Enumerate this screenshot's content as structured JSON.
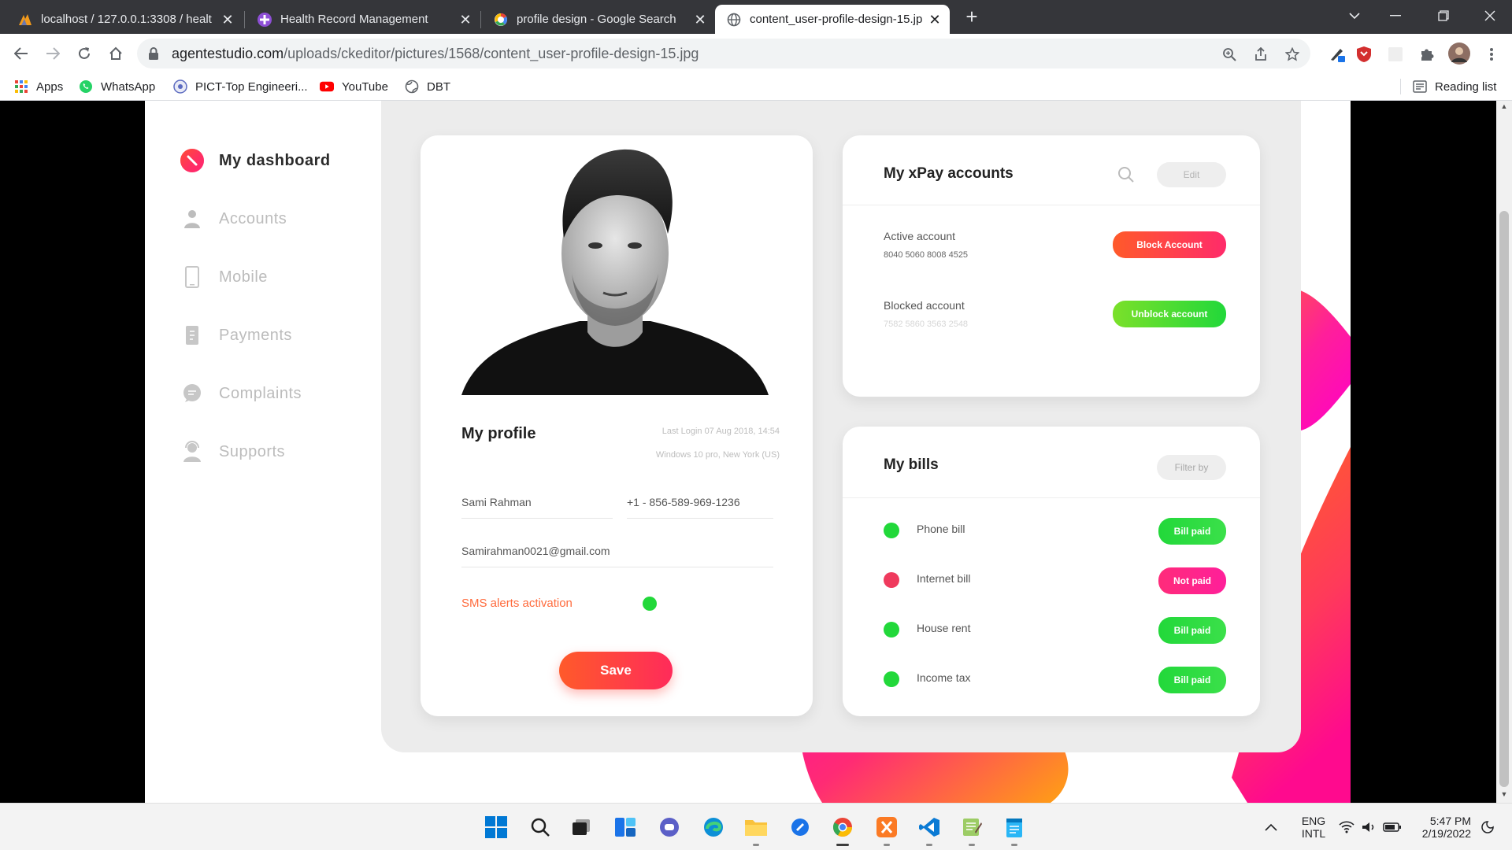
{
  "browser": {
    "tabs": [
      {
        "title": "localhost / 127.0.0.1:3308 / healt",
        "icon": "phpmyadmin-icon",
        "active": false
      },
      {
        "title": "Health Record Management",
        "icon": "plus-icon",
        "active": false
      },
      {
        "title": "profile design - Google Search",
        "icon": "google-icon",
        "active": false
      },
      {
        "title": "content_user-profile-design-15.jp",
        "icon": "globe-icon",
        "active": true
      }
    ],
    "close_glyph": "✕",
    "new_tab_glyph": "+",
    "url_host": "agentestudio.com",
    "url_path": "/uploads/ckeditor/pictures/1568/content_user-profile-design-15.jpg"
  },
  "bookmarks": [
    {
      "label": "Apps",
      "icon": "apps-grid-icon"
    },
    {
      "label": "WhatsApp",
      "icon": "whatsapp-icon"
    },
    {
      "label": "PICT-Top Engineeri...",
      "icon": "pict-logo-icon"
    },
    {
      "label": "YouTube",
      "icon": "youtube-icon"
    },
    {
      "label": "DBT",
      "icon": "globe-icon"
    }
  ],
  "reading_list": "Reading list",
  "design": {
    "menu": [
      {
        "label": "My dashboard",
        "icon": "dashboard-icon",
        "active": true
      },
      {
        "label": "Accounts",
        "icon": "user-icon",
        "active": false
      },
      {
        "label": "Mobile",
        "icon": "mobile-icon",
        "active": false
      },
      {
        "label": "Payments",
        "icon": "payments-icon",
        "active": false
      },
      {
        "label": "Complaints",
        "icon": "chat-icon",
        "active": false
      },
      {
        "label": "Supports",
        "icon": "support-icon",
        "active": false
      }
    ],
    "profile": {
      "title": "My profile",
      "last_login": "Last Login 07 Aug 2018, 14:54",
      "device": "Windows 10 pro, New York (US)",
      "name": "Sami Rahman",
      "phone": "+1 - 856-589-969-1236",
      "email": "Samirahman0021@gmail.com",
      "sms_label": "SMS alerts activation",
      "save_label": "Save"
    },
    "xpay": {
      "title": "My xPay accounts",
      "edit_label": "Edit",
      "active_label": "Active account",
      "active_number": "8040 5060 8008 4525",
      "block_label": "Block Account",
      "blocked_label": "Blocked account",
      "blocked_number": "7582 5860 3563 2548",
      "unblock_label": "Unblock account"
    },
    "bills": {
      "title": "My bills",
      "filter_label": "Filter by",
      "items": [
        {
          "name": "Phone bill",
          "status": "Bill paid",
          "paid": true
        },
        {
          "name": "Internet bill",
          "status": "Not paid",
          "paid": false
        },
        {
          "name": "House rent",
          "status": "Bill paid",
          "paid": true
        },
        {
          "name": "Income tax",
          "status": "Bill paid",
          "paid": true
        }
      ]
    }
  },
  "taskbar": {
    "apps": [
      "windows-start-icon",
      "search-icon",
      "task-view-icon",
      "widgets-icon",
      "teams-chat-icon",
      "edge-icon",
      "file-explorer-icon",
      "whiteboard-icon",
      "chrome-icon",
      "xampp-icon",
      "vscode-icon",
      "notepadpp-icon",
      "notepad-icon"
    ],
    "lang_top": "ENG",
    "lang_bottom": "INTL",
    "time": "5:47 PM",
    "date": "2/19/2022"
  },
  "colors": {
    "accent_orange": "#ff6a2a",
    "accent_pink": "#ff1f7a",
    "green": "#22d83a",
    "red": "#ef3a5d"
  }
}
